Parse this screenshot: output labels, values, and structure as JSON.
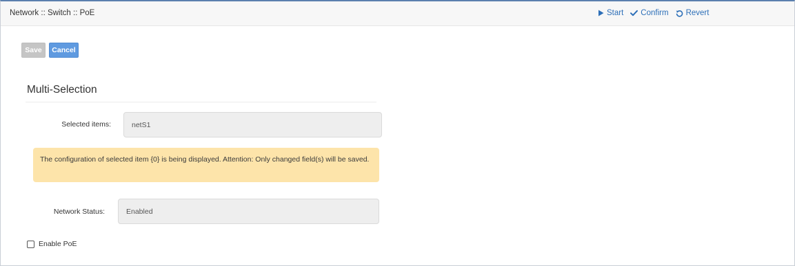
{
  "header": {
    "breadcrumb": "Network :: Switch :: PoE",
    "actions": {
      "start": "Start",
      "confirm": "Confirm",
      "revert": "Revert"
    },
    "accent_color": "#2d6fb8"
  },
  "toolbar": {
    "save_label": "Save",
    "cancel_label": "Cancel"
  },
  "section": {
    "title": "Multi-Selection"
  },
  "form": {
    "selected_items": {
      "label": "Selected items:",
      "value": "netS1"
    },
    "alert": {
      "text": "The configuration of selected item {0} is being displayed. Attention: Only changed field(s) will be saved."
    },
    "network_status": {
      "label": "Network Status:",
      "value": "Enabled"
    },
    "enable_poe": {
      "label": "Enable PoE",
      "checked": false
    }
  }
}
